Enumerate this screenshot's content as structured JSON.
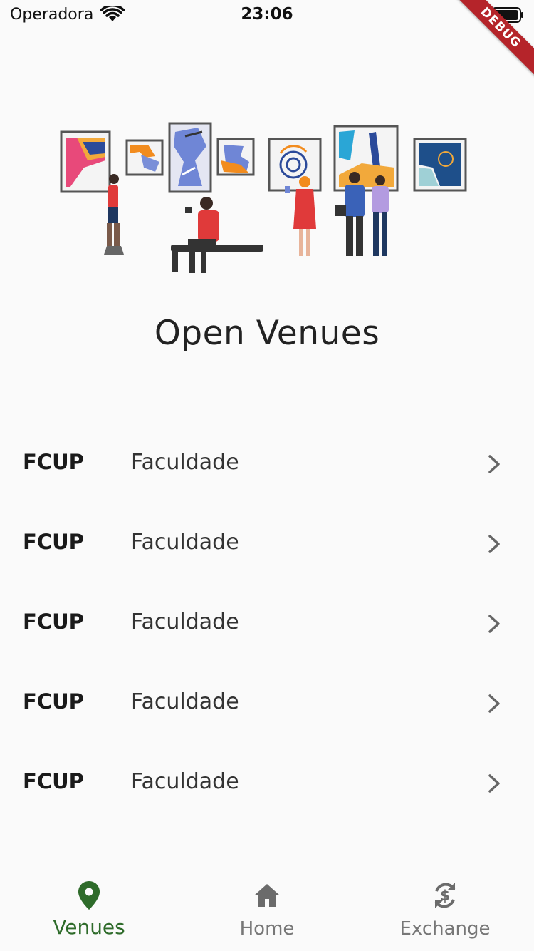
{
  "status_bar": {
    "carrier": "Operadora",
    "time": "23:06"
  },
  "debug_banner": "DEBUG",
  "page": {
    "title": "Open Venues"
  },
  "venues": [
    {
      "code": "FCUP",
      "name": "Faculdade"
    },
    {
      "code": "FCUP",
      "name": "Faculdade"
    },
    {
      "code": "FCUP",
      "name": "Faculdade"
    },
    {
      "code": "FCUP",
      "name": "Faculdade"
    },
    {
      "code": "FCUP",
      "name": "Faculdade"
    }
  ],
  "bottom_nav": {
    "items": [
      {
        "label": "Venues",
        "icon": "location-pin-icon",
        "active": true
      },
      {
        "label": "Home",
        "icon": "home-icon",
        "active": false
      },
      {
        "label": "Exchange",
        "icon": "currency-exchange-icon",
        "active": false
      }
    ]
  },
  "colors": {
    "background": "#fafafa",
    "accent": "#2e6b2a",
    "inactive": "#777777",
    "debug_ribbon": "#b5242a"
  }
}
